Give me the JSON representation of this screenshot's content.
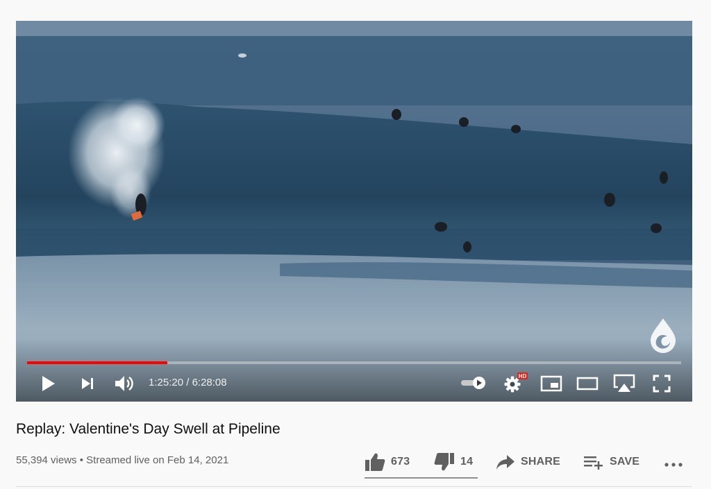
{
  "player": {
    "current_time": "1:25:20",
    "separator": " / ",
    "duration": "6:28:08",
    "progress": 0.214,
    "hd_badge": "HD",
    "accent_color": "#ff0000",
    "icons": [
      "play-icon",
      "next-icon",
      "volume-icon",
      "autoplay-toggle-icon",
      "settings-icon",
      "miniplayer-icon",
      "theater-icon",
      "airplay-icon",
      "fullscreen-icon",
      "channel-watermark-icon"
    ]
  },
  "video": {
    "title": "Replay: Valentine's Day Swell at Pipeline",
    "views": "55,394 views",
    "bullet": " • ",
    "streamed": "Streamed live on Feb 14, 2021"
  },
  "actions": {
    "likes": "673",
    "dislikes": "14",
    "share_label": "SHARE",
    "save_label": "SAVE",
    "more_icon": "more-horiz-icon"
  }
}
